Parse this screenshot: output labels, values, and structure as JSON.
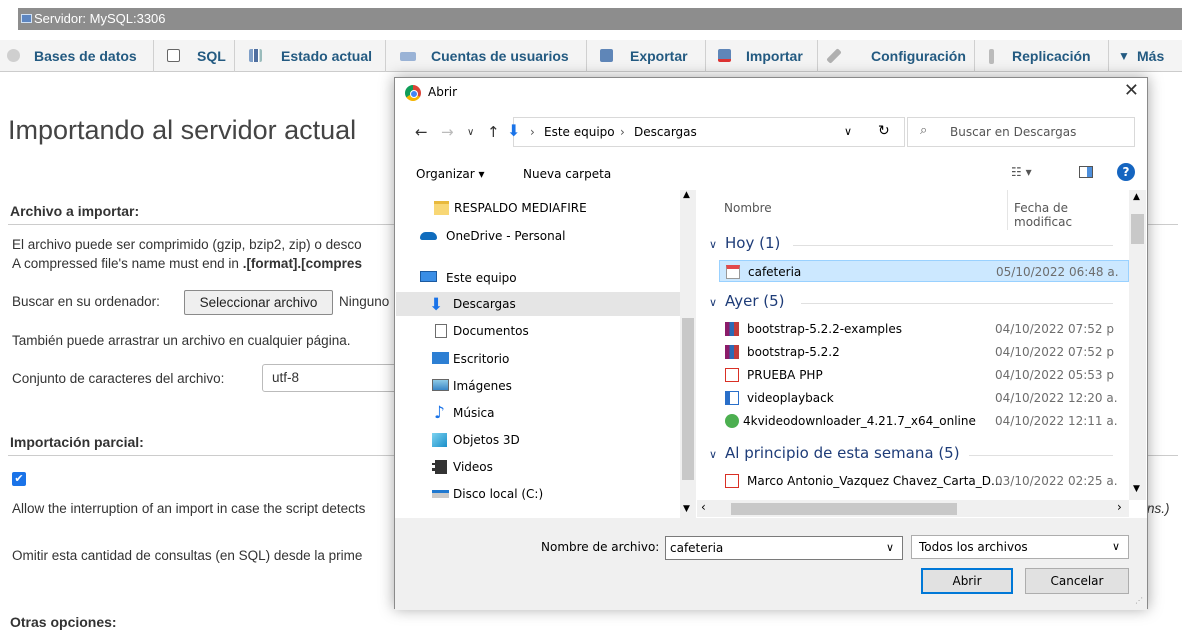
{
  "server_bar": {
    "label": "Servidor: MySQL:3306"
  },
  "tabs": [
    {
      "label": "Bases de datos",
      "icon": "database-icon"
    },
    {
      "label": "SQL",
      "icon": "sql-icon"
    },
    {
      "label": "Estado actual",
      "icon": "status-chart-icon"
    },
    {
      "label": "Cuentas de usuarios",
      "icon": "user-accounts-icon"
    },
    {
      "label": "Exportar",
      "icon": "export-icon"
    },
    {
      "label": "Importar",
      "icon": "import-icon"
    },
    {
      "label": "Configuración",
      "icon": "wrench-icon"
    },
    {
      "label": "Replicación",
      "icon": "replication-icon"
    },
    {
      "label": "Más",
      "icon": "triangle-down-icon"
    }
  ],
  "main": {
    "title": "Importando al servidor actual",
    "file_section": {
      "heading": "Archivo a importar:",
      "desc1": "El archivo puede ser comprimido (gzip, bzip2, zip) o desco",
      "desc2_prefix": "A compressed file's name must end in ",
      "desc2_bold": ".[format].[compres",
      "browse_label": "Buscar en su ordenador:",
      "select_button": "Seleccionar archivo",
      "no_file": "Ninguno",
      "drag_hint": "También puede arrastrar un archivo en cualquier página.",
      "charset_label": "Conjunto de caracteres del archivo:",
      "charset_value": "utf-8"
    },
    "partial_section": {
      "heading": "Importación parcial:",
      "allow_interrupt": "Allow the interruption of an import in case the script detects",
      "allow_interrupt_tail": "ns.)",
      "skip_queries": "Omitir esta cantidad de consultas (en SQL) desde la prime"
    },
    "other_heading": "Otras opciones:"
  },
  "dialog": {
    "title": "Abrir",
    "path": [
      "Este equipo",
      "Descargas"
    ],
    "search_placeholder": "Buscar en Descargas",
    "organize": "Organizar",
    "new_folder": "Nueva carpeta",
    "nav_items": [
      {
        "label": "RESPALDO MEDIAFIRE",
        "icon": "folder-icon"
      },
      {
        "label": "OneDrive - Personal",
        "icon": "onedrive-cloud-icon"
      },
      {
        "label": "Este equipo",
        "icon": "computer-icon"
      },
      {
        "label": "Descargas",
        "icon": "downloads-arrow-icon"
      },
      {
        "label": "Documentos",
        "icon": "documents-icon"
      },
      {
        "label": "Escritorio",
        "icon": "desktop-icon"
      },
      {
        "label": "Imágenes",
        "icon": "pictures-icon"
      },
      {
        "label": "Música",
        "icon": "music-note-icon"
      },
      {
        "label": "Objetos 3D",
        "icon": "objects-3d-icon"
      },
      {
        "label": "Videos",
        "icon": "videos-icon"
      },
      {
        "label": "Disco local (C:)",
        "icon": "local-disk-icon"
      }
    ],
    "columns": {
      "name": "Nombre",
      "date": "Fecha de modificac"
    },
    "groups": [
      {
        "label": "Hoy (1)",
        "files": [
          {
            "name": "cafeteria",
            "date": "05/10/2022 06:48 a.",
            "icon": "sql-file-icon"
          }
        ]
      },
      {
        "label": "Ayer (5)",
        "files": [
          {
            "name": "bootstrap-5.2.2-examples",
            "date": "04/10/2022 07:52 p",
            "icon": "winrar-archive-icon"
          },
          {
            "name": "bootstrap-5.2.2",
            "date": "04/10/2022 07:52 p",
            "icon": "winrar-archive-icon"
          },
          {
            "name": "PRUEBA PHP",
            "date": "04/10/2022 05:53 p",
            "icon": "pdf-icon"
          },
          {
            "name": "videoplayback",
            "date": "04/10/2022 12:20 a.",
            "icon": "video-file-icon"
          },
          {
            "name": "4kvideodownloader_4.21.7_x64_online",
            "date": "04/10/2022 12:11 a.",
            "icon": "installer-icon"
          }
        ]
      },
      {
        "label": "Al principio de esta semana (5)",
        "files": [
          {
            "name": "Marco Antonio_Vazquez Chavez_Carta_D...",
            "date": "03/10/2022 02:25 a.",
            "icon": "pdf-icon"
          }
        ]
      }
    ],
    "filename_label": "Nombre de archivo:",
    "filename_value": "cafeteria",
    "filetype_value": "Todos los archivos",
    "open_button": "Abrir",
    "cancel_button": "Cancelar"
  }
}
